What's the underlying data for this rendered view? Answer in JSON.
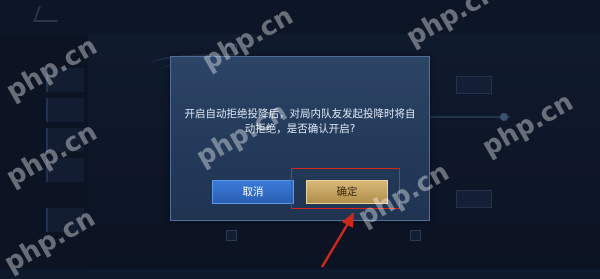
{
  "dialog": {
    "message": "开启自动拒绝投降后，对局内队友发起投降时将自动拒绝，是否确认开启?",
    "cancel_label": "取消",
    "confirm_label": "确定"
  },
  "watermark": {
    "text": "php.cn"
  },
  "colors": {
    "cancel_button": "#2f6cc6",
    "confirm_button": "#c9a865",
    "highlight": "#d0271d",
    "dialog_bg": "#28405f"
  }
}
